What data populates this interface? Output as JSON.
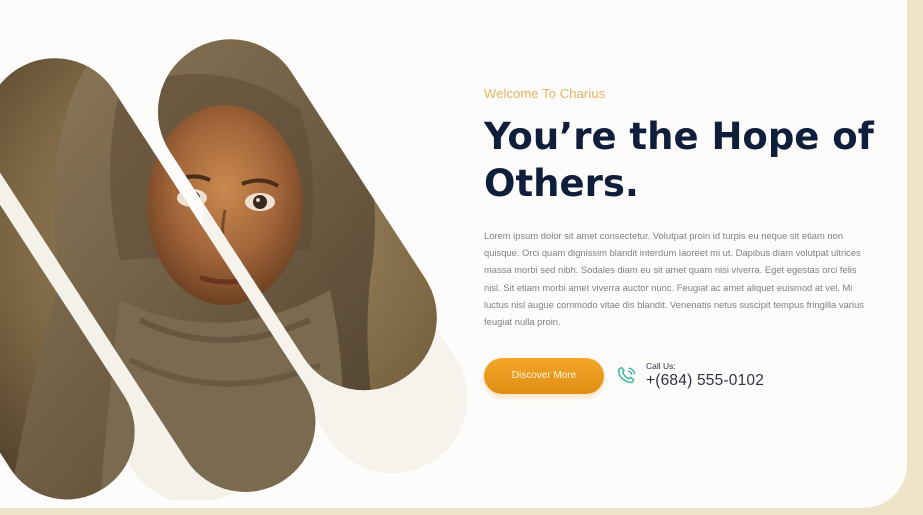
{
  "hero": {
    "eyebrow": "Welcome To Charius",
    "headline_line1": "You’re the Hope of",
    "headline_line2": "Others.",
    "description": "Lorem ipsum dolor sit amet consectetur. Volutpat proin id turpis eu neque sit etiam non quisque. Orci quam dignissim blandit interdum laoreet mi ut. Dapibus diam volutpat ultrices massa morbi sed nibh. Sodales diam eu sit amet quam nisi viverra. Eget egestas orci felis nisl. Sit etiam morbi amet viverra auctor nunc. Feugiat ac amet aliquet euismod at vel. Mi luctus nisl augue commodo vitae dis blandit. Venenatis netus suscipit tempus fringilla varius feugiat nulla proin.",
    "cta_label": "Discover More",
    "call_label": "Call Us:",
    "phone": "+(684) 555-0102"
  },
  "colors": {
    "accent": "#e8961a",
    "eyebrow": "#e3b35e",
    "heading": "#0f1f3b",
    "phone_icon": "#46b8a3",
    "page_background": "#ece3c8"
  },
  "icons": {
    "phone": "phone-icon"
  }
}
